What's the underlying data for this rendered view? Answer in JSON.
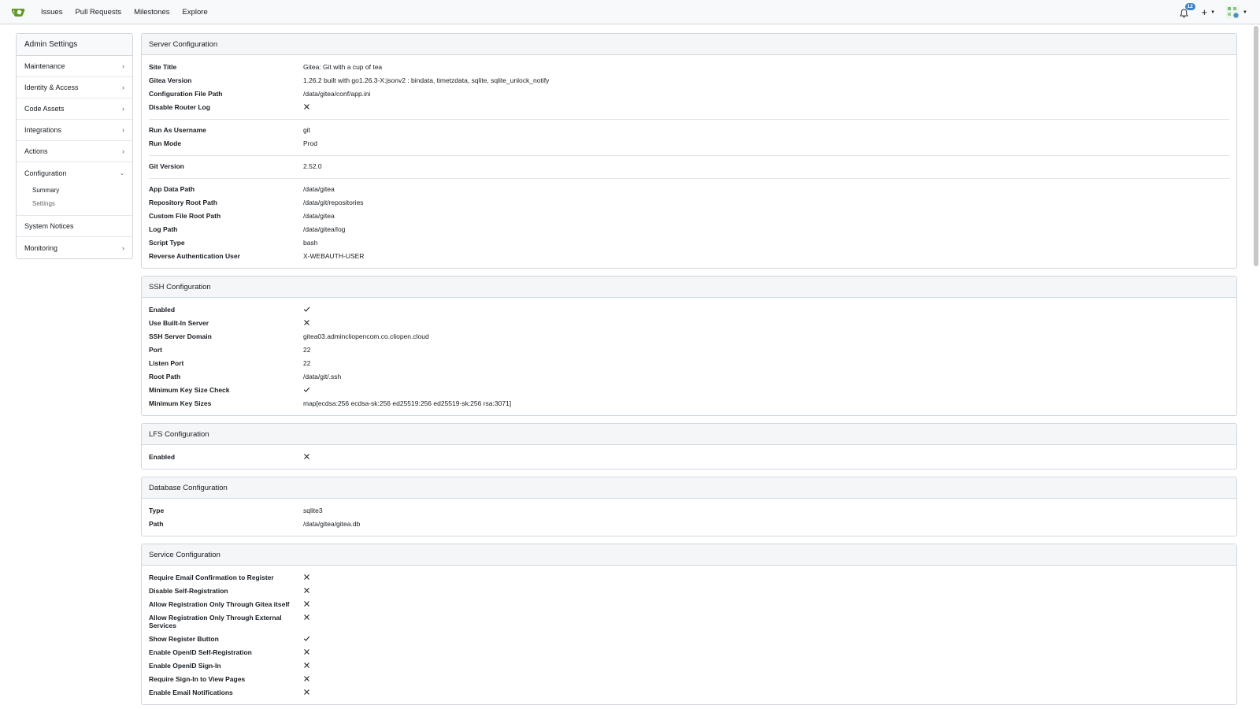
{
  "nav": {
    "links": [
      "Issues",
      "Pull Requests",
      "Milestones",
      "Explore"
    ],
    "notification_count": "12",
    "colors": {
      "logo": "#609926",
      "badge": "#4183c4"
    }
  },
  "sidebar": {
    "title": "Admin Settings",
    "items": [
      {
        "label": "Maintenance"
      },
      {
        "label": "Identity & Access"
      },
      {
        "label": "Code Assets"
      },
      {
        "label": "Integrations"
      },
      {
        "label": "Actions"
      },
      {
        "label": "Configuration"
      },
      {
        "label": "System Notices"
      },
      {
        "label": "Monitoring"
      }
    ],
    "config_sub": [
      "Summary",
      "Settings"
    ]
  },
  "server": {
    "title": "Server Configuration",
    "site_title_k": "Site Title",
    "site_title_v": "Gitea: Git with a cup of tea",
    "gitea_version_k": "Gitea Version",
    "gitea_version_v": "1.26.2 built with go1.26.3-X:jsonv2 : bindata, timetzdata, sqlite, sqlite_unlock_notify",
    "config_path_k": "Configuration File Path",
    "config_path_v": "/data/gitea/conf/app.ini",
    "disable_router_log_k": "Disable Router Log",
    "run_as_k": "Run As Username",
    "run_as_v": "git",
    "run_mode_k": "Run Mode",
    "run_mode_v": "Prod",
    "git_version_k": "Git Version",
    "git_version_v": "2.52.0",
    "app_data_k": "App Data Path",
    "app_data_v": "/data/gitea",
    "repo_root_k": "Repository Root Path",
    "repo_root_v": "/data/git/repositories",
    "custom_root_k": "Custom File Root Path",
    "custom_root_v": "/data/gitea",
    "log_path_k": "Log Path",
    "log_path_v": "/data/gitea/log",
    "script_type_k": "Script Type",
    "script_type_v": "bash",
    "rev_auth_k": "Reverse Authentication User",
    "rev_auth_v": "X-WEBAUTH-USER"
  },
  "ssh": {
    "title": "SSH Configuration",
    "enabled_k": "Enabled",
    "builtin_k": "Use Built-In Server",
    "domain_k": "SSH Server Domain",
    "domain_v": "gitea03.admincliopencom.co.cliopen.cloud",
    "port_k": "Port",
    "port_v": "22",
    "listen_port_k": "Listen Port",
    "listen_port_v": "22",
    "root_path_k": "Root Path",
    "root_path_v": "/data/git/.ssh",
    "min_key_check_k": "Minimum Key Size Check",
    "min_key_sizes_k": "Minimum Key Sizes",
    "min_key_sizes_v": "map[ecdsa:256 ecdsa-sk:256 ed25519:256 ed25519-sk:256 rsa:3071]"
  },
  "lfs": {
    "title": "LFS Configuration",
    "enabled_k": "Enabled"
  },
  "db": {
    "title": "Database Configuration",
    "type_k": "Type",
    "type_v": "sqlite3",
    "path_k": "Path",
    "path_v": "/data/gitea/gitea.db"
  },
  "service": {
    "title": "Service Configuration",
    "rows": [
      {
        "k": "Require Email Confirmation to Register",
        "v": "cross"
      },
      {
        "k": "Disable Self-Registration",
        "v": "cross"
      },
      {
        "k": "Allow Registration Only Through Gitea itself",
        "v": "cross"
      },
      {
        "k": "Allow Registration Only Through External Services",
        "v": "cross"
      },
      {
        "k": "Show Register Button",
        "v": "check"
      },
      {
        "k": "Enable OpenID Self-Registration",
        "v": "cross"
      },
      {
        "k": "Enable OpenID Sign-In",
        "v": "cross"
      },
      {
        "k": "Require Sign-In to View Pages",
        "v": "cross"
      },
      {
        "k": "Enable Email Notifications",
        "v": "cross"
      }
    ]
  }
}
